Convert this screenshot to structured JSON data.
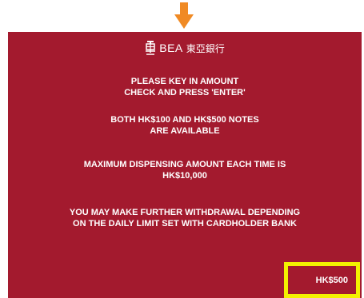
{
  "colors": {
    "screen_background": "#a31a2e",
    "arrow": "#f08a24",
    "highlight": "#f3f000",
    "text": "#ffffff"
  },
  "header": {
    "brand_latin": "BEA",
    "brand_cjk": "東亞銀行",
    "emblem_icon": "bea-emblem-icon"
  },
  "pointer_icon": "down-arrow-icon",
  "messages": {
    "enter_amount": [
      "PLEASE KEY IN AMOUNT",
      "CHECK AND PRESS 'ENTER'"
    ],
    "notes_available": [
      "BOTH HK$100 AND HK$500 NOTES",
      "ARE AVAILABLE"
    ],
    "max_dispensing": [
      "MAXIMUM DISPENSING AMOUNT EACH TIME IS",
      "HK$10,000"
    ],
    "further_withdrawal": [
      "YOU MAY MAKE FURTHER WITHDRAWAL DEPENDING",
      "ON THE DAILY LIMIT SET WITH CARDHOLDER BANK"
    ]
  },
  "option_button": {
    "label": "HK$500"
  }
}
